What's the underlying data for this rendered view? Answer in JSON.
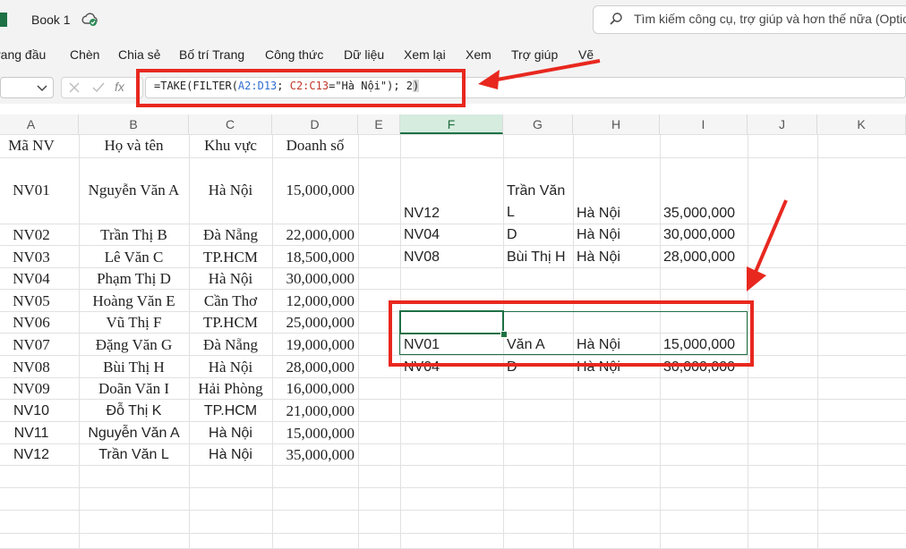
{
  "app": {
    "title": "Book 1",
    "search_placeholder": "Tìm kiếm công cụ, trợ giúp và hơn thế nữa (Optio",
    "accent": "#1e7145",
    "annotation_color": "#e8281f"
  },
  "menu": [
    "rang đầu",
    "Chèn",
    "Chia sẻ",
    "Bố trí Trang",
    "Công thức",
    "Dữ liệu",
    "Xem lại",
    "Xem",
    "Trợ giúp",
    "Vẽ"
  ],
  "formula_bar": {
    "fx_label": "fx",
    "formula_parts": [
      "=TAKE(FILTER(",
      "A2:D13",
      "; ",
      "C2:C13",
      "=\"Hà Nội\"); 2",
      ")"
    ]
  },
  "columns": [
    "A",
    "B",
    "C",
    "D",
    "E",
    "F",
    "G",
    "H",
    "I",
    "J",
    "K"
  ],
  "selected_column": "F",
  "source_table": {
    "headers": [
      "Mã NV",
      "Họ và tên",
      "Khu vực",
      "Doanh số"
    ],
    "rows": [
      [
        "NV01",
        "Nguyễn Văn A",
        "Hà Nội",
        "15,000,000"
      ],
      [
        "NV02",
        "Trần Thị B",
        "Đà Nẵng",
        "22,000,000"
      ],
      [
        "NV03",
        "Lê Văn C",
        "TP.HCM",
        "18,500,000"
      ],
      [
        "NV04",
        "Phạm Thị D",
        "Hà Nội",
        "30,000,000"
      ],
      [
        "NV05",
        "Hoàng Văn E",
        "Cần Thơ",
        "12,000,000"
      ],
      [
        "NV06",
        "Vũ Thị F",
        "TP.HCM",
        "25,000,000"
      ],
      [
        "NV07",
        "Đặng Văn G",
        "Đà Nẵng",
        "19,000,000"
      ],
      [
        "NV08",
        "Bùi Thị H",
        "Hà Nội",
        "28,000,000"
      ],
      [
        "NV09",
        "Doãn Văn I",
        "Hải Phòng",
        "16,000,000"
      ],
      [
        "NV10",
        "Đỗ Thị K",
        "TP.HCM",
        "21,000,000"
      ],
      [
        "NV11",
        "Nguyễn Văn A",
        "Hà Nội",
        "15,000,000"
      ],
      [
        "NV12",
        "Trần Văn L",
        "Hà Nội",
        "35,000,000"
      ]
    ]
  },
  "filter_result": {
    "rows": [
      [
        "NV12",
        "Trần Văn\nL",
        "Hà Nội",
        "35,000,000"
      ],
      [
        "NV04",
        "D",
        "Hà Nội",
        "30,000,000"
      ],
      [
        "NV08",
        "Bùi Thị H",
        "Hà Nội",
        "28,000,000"
      ]
    ]
  },
  "take_result": {
    "rows": [
      [
        "NV01",
        "Văn A",
        "Hà Nội",
        "15,000,000"
      ],
      [
        "NV04",
        "D",
        "Hà Nội",
        "30,000,000"
      ]
    ]
  }
}
